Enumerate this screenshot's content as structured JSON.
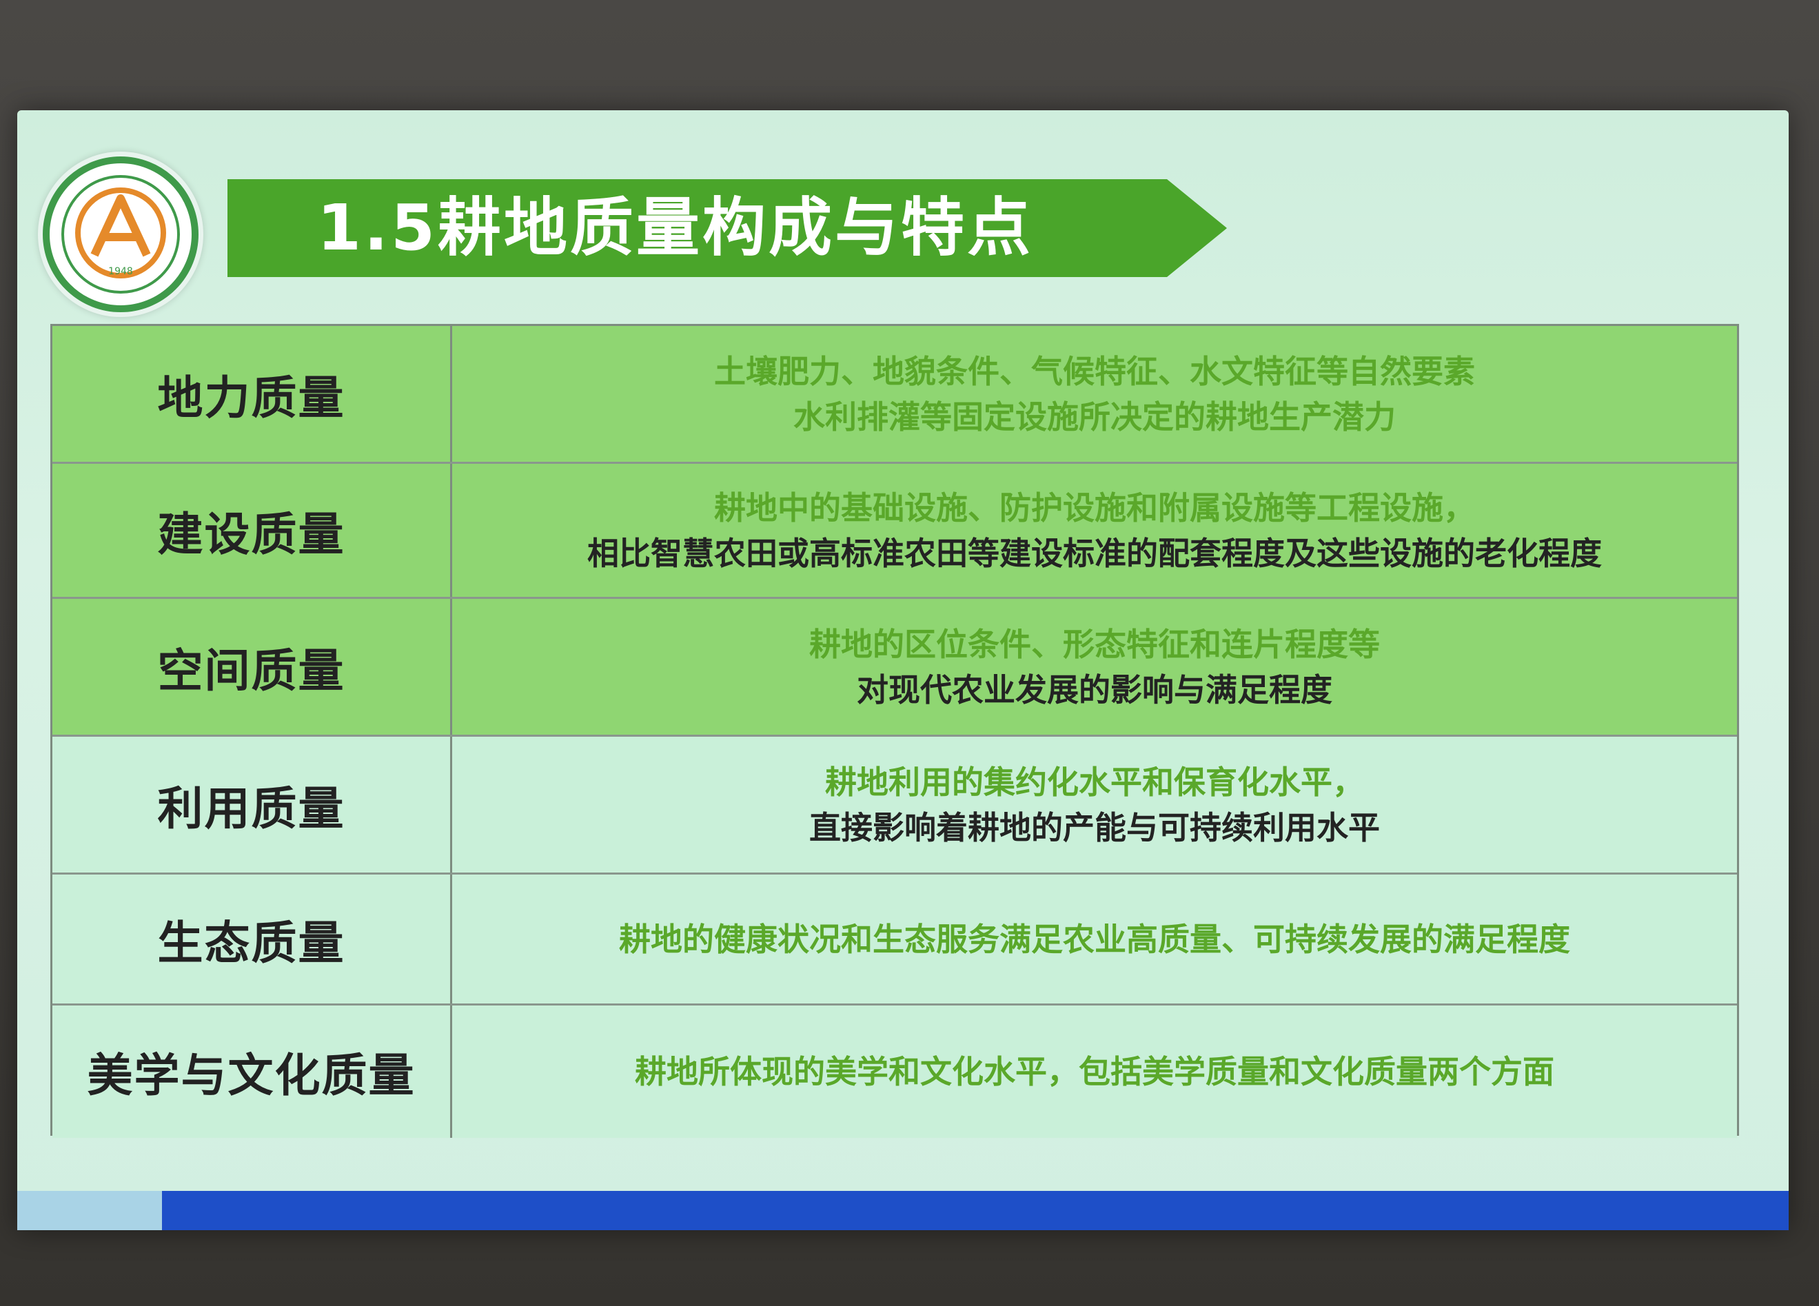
{
  "slide": {
    "title": "1.5耕地质量构成与特点"
  },
  "colors": {
    "banner": "#4aa52a",
    "row_green": "#8fd672",
    "row_pale": "#c9f0d9",
    "text_green": "#5aa82a",
    "text_dark": "#232323",
    "bottom_bar": "#1e4fc8"
  },
  "logo": {
    "icon": "university-seal-icon",
    "letter": "A",
    "year": "1948"
  },
  "table": {
    "rows": [
      {
        "label": "地力质量",
        "lines": [
          {
            "text": "土壤肥力、地貌条件、气候特征、水文特征等自然要素",
            "tone": "green"
          },
          {
            "text": "水利排灌等固定设施所决定的耕地生产潜力",
            "tone": "green"
          }
        ]
      },
      {
        "label": "建设质量",
        "lines": [
          {
            "text": "耕地中的基础设施、防护设施和附属设施等工程设施，",
            "tone": "green"
          },
          {
            "text": "相比智慧农田或高标准农田等建设标准的配套程度及这些设施的老化程度",
            "tone": "dark"
          }
        ]
      },
      {
        "label": "空间质量",
        "lines": [
          {
            "text": "耕地的区位条件、形态特征和连片程度等",
            "tone": "green"
          },
          {
            "text": "对现代农业发展的影响与满足程度",
            "tone": "dark"
          }
        ]
      },
      {
        "label": "利用质量",
        "lines": [
          {
            "text": "耕地利用的集约化水平和保育化水平，",
            "tone": "green"
          },
          {
            "text": "直接影响着耕地的产能与可持续利用水平",
            "tone": "dark"
          }
        ]
      },
      {
        "label": "生态质量",
        "lines": [
          {
            "text": "耕地的健康状况和生态服务满足农业高质量、可持续发展的满足程度",
            "tone": "green"
          }
        ]
      },
      {
        "label": "美学与文化质量",
        "lines": [
          {
            "text": "耕地所体现的美学和文化水平，包括美学质量和文化质量两个方面",
            "tone": "green"
          }
        ]
      }
    ]
  }
}
